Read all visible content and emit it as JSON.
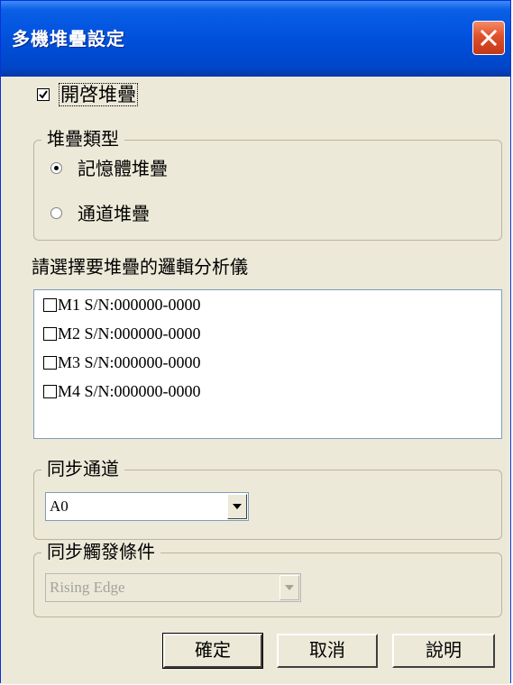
{
  "window": {
    "title": "多機堆疊設定"
  },
  "enable_stack": {
    "label": "開啓堆疊",
    "checked": true
  },
  "stack_type": {
    "legend": "堆疊類型",
    "options": [
      {
        "label": "記憶體堆疊",
        "selected": true
      },
      {
        "label": "通道堆疊",
        "selected": false
      }
    ]
  },
  "analyzer_select": {
    "label": "請選擇要堆疊的邏輯分析儀",
    "items": [
      {
        "text": "M1 S/N:000000-0000",
        "checked": false
      },
      {
        "text": "M2 S/N:000000-0000",
        "checked": false
      },
      {
        "text": "M3 S/N:000000-0000",
        "checked": false
      },
      {
        "text": "M4 S/N:000000-0000",
        "checked": false
      }
    ]
  },
  "sync_channel": {
    "legend": "同步通道",
    "value": "A0"
  },
  "sync_trigger": {
    "legend": "同步觸發條件",
    "value": "Rising Edge",
    "disabled": true
  },
  "buttons": {
    "ok": "確定",
    "cancel": "取消",
    "help": "說明"
  }
}
